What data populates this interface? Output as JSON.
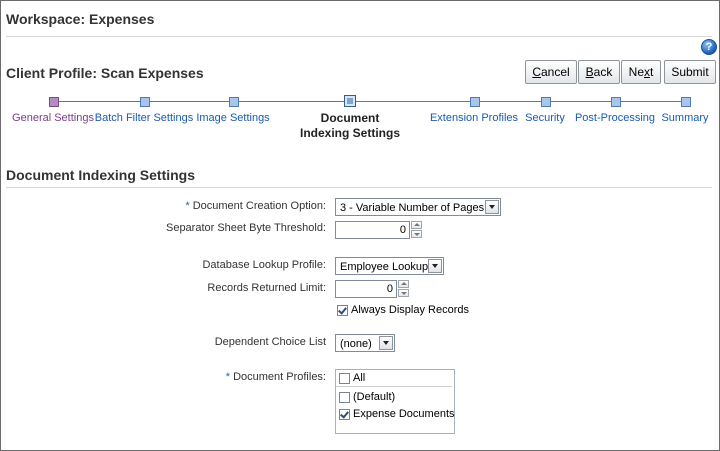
{
  "workspace": {
    "title": "Workspace: Expenses"
  },
  "help": {
    "label": "?"
  },
  "profile": {
    "title": "Client Profile: Scan Expenses"
  },
  "buttons": {
    "cancel": {
      "mn": "C",
      "rest": "ancel"
    },
    "back": {
      "mn": "B",
      "rest": "ack"
    },
    "next": {
      "pre": "Ne",
      "mn": "x",
      "rest": "t"
    },
    "submit": {
      "label": "Submit"
    }
  },
  "train": [
    {
      "label": "General Settings",
      "state": "visited"
    },
    {
      "label": "Batch Filter Settings",
      "state": "normal"
    },
    {
      "label": "Image Settings",
      "state": "normal"
    },
    {
      "label": "Document Indexing Settings",
      "state": "current"
    },
    {
      "label": "Extension Profiles",
      "state": "normal"
    },
    {
      "label": "Security",
      "state": "normal"
    },
    {
      "label": "Post-Processing",
      "state": "normal"
    },
    {
      "label": "Summary",
      "state": "normal"
    }
  ],
  "section": {
    "title": "Document Indexing Settings"
  },
  "form": {
    "required_marker": "*",
    "doc_creation": {
      "label": "Document Creation Option:",
      "value": "3 - Variable Number of Pages"
    },
    "separator": {
      "label": "Separator Sheet Byte Threshold:",
      "value": "0"
    },
    "db_lookup": {
      "label": "Database Lookup Profile:",
      "value": "Employee Lookup"
    },
    "records_limit": {
      "label": "Records Returned Limit:",
      "value": "0"
    },
    "always_display": {
      "label": "Always Display Records",
      "checked": true
    },
    "dependent": {
      "label": "Dependent Choice List",
      "value": "(none)"
    },
    "doc_profiles": {
      "label": "Document Profiles:",
      "all": {
        "label": "All",
        "checked": false
      },
      "items": [
        {
          "label": "(Default)",
          "checked": false
        },
        {
          "label": "Expense Documents",
          "checked": true
        }
      ]
    }
  },
  "colors": {
    "train_link": "#1a5bb0",
    "train_visited": "#7a3c8c",
    "required": "#2561b5"
  }
}
